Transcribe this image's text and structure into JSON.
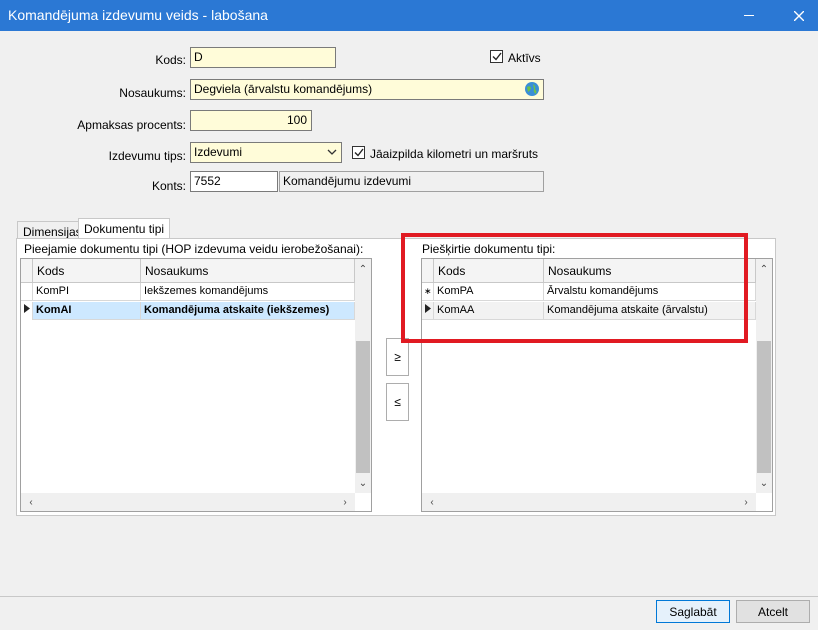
{
  "window": {
    "title": "Komandējuma izdevumu veids - labošana",
    "min_icon": "minimize-icon",
    "close_icon": "close-icon"
  },
  "form": {
    "kods_label": "Kods:",
    "kods_value": "D",
    "aktivs_label": "Aktīvs",
    "aktivs_checked": true,
    "nosaukums_label": "Nosaukums:",
    "nosaukums_value": "Degviela (ārvalstu komandējums)",
    "apmaksas_label": "Apmaksas procents:",
    "apmaksas_value": "100",
    "izdevumu_tips_label": "Izdevumu tips:",
    "izdevumu_tips_value": "Izdevumi",
    "km_label": "Jāaizpilda kilometri un maršruts",
    "km_checked": true,
    "konts_label": "Konts:",
    "konts_value": "7552",
    "konts_name": "Komandējumu izdevumi"
  },
  "tabs": [
    {
      "label": "Dimensijas"
    },
    {
      "label": "Dokumentu tipi"
    }
  ],
  "available": {
    "title": "Pieejamie dokumentu tipi (HOP izdevuma veidu ierobežošanai):",
    "columns": [
      "Kods",
      "Nosaukums"
    ],
    "rows": [
      {
        "kods": "KomPI",
        "nosaukums": "Iekšzemes komandējums"
      },
      {
        "kods": "KomAI",
        "nosaukums": "Komandējuma atskaite (iekšzemes)"
      }
    ]
  },
  "assigned": {
    "title": "Piešķirtie dokumentu tipi:",
    "columns": [
      "Kods",
      "Nosaukums"
    ],
    "rows": [
      {
        "kods": "KomPA",
        "nosaukums": "Ārvalstu komandējums"
      },
      {
        "kods": "KomAA",
        "nosaukums": "Komandējuma atskaite (ārvalstu)"
      }
    ]
  },
  "move_buttons": {
    "add": "≥",
    "remove": "≤"
  },
  "footer": {
    "save": "Saglabāt",
    "cancel": "Atcelt"
  },
  "colors": {
    "titlebar": "#2b78d4",
    "required_field": "#fffcd9",
    "highlight": "#e11a22",
    "selection": "#cde8ff"
  }
}
